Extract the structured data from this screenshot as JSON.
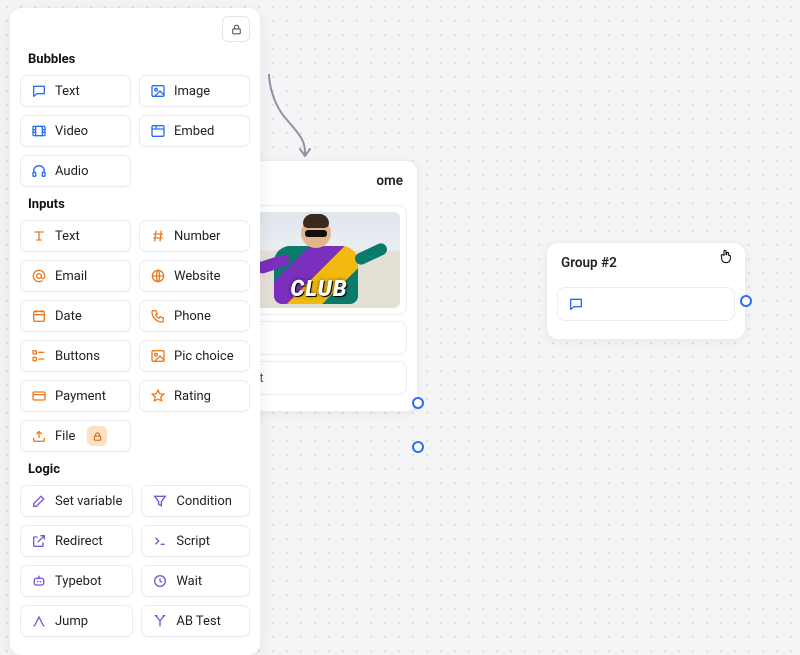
{
  "panel": {
    "sections": {
      "bubbles": {
        "title": "Bubbles",
        "items": [
          {
            "key": "text",
            "label": "Text"
          },
          {
            "key": "image",
            "label": "Image"
          },
          {
            "key": "video",
            "label": "Video"
          },
          {
            "key": "embed",
            "label": "Embed"
          },
          {
            "key": "audio",
            "label": "Audio"
          }
        ]
      },
      "inputs": {
        "title": "Inputs",
        "items": [
          {
            "key": "text",
            "label": "Text"
          },
          {
            "key": "number",
            "label": "Number"
          },
          {
            "key": "email",
            "label": "Email"
          },
          {
            "key": "website",
            "label": "Website"
          },
          {
            "key": "date",
            "label": "Date"
          },
          {
            "key": "phone",
            "label": "Phone"
          },
          {
            "key": "buttons",
            "label": "Buttons"
          },
          {
            "key": "picchoice",
            "label": "Pic choice"
          },
          {
            "key": "payment",
            "label": "Payment"
          },
          {
            "key": "rating",
            "label": "Rating"
          },
          {
            "key": "file",
            "label": "File",
            "locked": true
          }
        ]
      },
      "logic": {
        "title": "Logic",
        "items": [
          {
            "key": "setvar",
            "label": "Set variable"
          },
          {
            "key": "condition",
            "label": "Condition"
          },
          {
            "key": "redirect",
            "label": "Redirect"
          },
          {
            "key": "script",
            "label": "Script"
          },
          {
            "key": "typebot",
            "label": "Typebot"
          },
          {
            "key": "wait",
            "label": "Wait"
          },
          {
            "key": "jump",
            "label": "Jump"
          },
          {
            "key": "abtest",
            "label": "AB Test"
          }
        ]
      }
    }
  },
  "canvas": {
    "node1": {
      "title_visible": "ome",
      "image_caption": "CLUB",
      "empty_block": "",
      "default_block": "ault"
    },
    "node2": {
      "title": "Group #2"
    }
  }
}
